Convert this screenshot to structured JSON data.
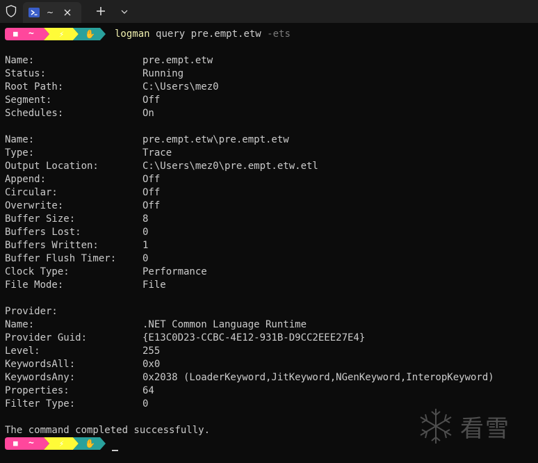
{
  "tabbar": {
    "tab_title": "~",
    "icons": [
      "shield-icon",
      "powershell-icon",
      "close-icon",
      "plus-icon",
      "chevron-down-icon"
    ]
  },
  "prompt": {
    "folder_glyph": "■",
    "home_glyph": "~",
    "bolt_glyph": "⚡",
    "hand_glyph": "✋",
    "colors": {
      "pink": "#ff479c",
      "yellow": "#fffb38",
      "teal": "#29a19c"
    }
  },
  "command": {
    "name": "logman",
    "args": "query pre.empt.etw",
    "flag": "-ets"
  },
  "session": [
    {
      "key": "Name:",
      "value": "pre.empt.etw"
    },
    {
      "key": "Status:",
      "value": "Running"
    },
    {
      "key": "Root Path:",
      "value": "C:\\Users\\mez0"
    },
    {
      "key": "Segment:",
      "value": "Off"
    },
    {
      "key": "Schedules:",
      "value": "On"
    }
  ],
  "trace": [
    {
      "key": "Name:",
      "value": "pre.empt.etw\\pre.empt.etw"
    },
    {
      "key": "Type:",
      "value": "Trace"
    },
    {
      "key": "Output Location:",
      "value": "C:\\Users\\mez0\\pre.empt.etw.etl"
    },
    {
      "key": "Append:",
      "value": "Off"
    },
    {
      "key": "Circular:",
      "value": "Off"
    },
    {
      "key": "Overwrite:",
      "value": "Off"
    },
    {
      "key": "Buffer Size:",
      "value": "8"
    },
    {
      "key": "Buffers Lost:",
      "value": "0"
    },
    {
      "key": "Buffers Written:",
      "value": "1"
    },
    {
      "key": "Buffer Flush Timer:",
      "value": "0"
    },
    {
      "key": "Clock Type:",
      "value": "Performance"
    },
    {
      "key": "File Mode:",
      "value": "File"
    }
  ],
  "provider_header": "Provider:",
  "provider": [
    {
      "key": "Name:",
      "value": ".NET Common Language Runtime"
    },
    {
      "key": "Provider Guid:",
      "value": "{E13C0D23-CCBC-4E12-931B-D9CC2EEE27E4}"
    },
    {
      "key": "Level:",
      "value": "255"
    },
    {
      "key": "KeywordsAll:",
      "value": "0x0"
    },
    {
      "key": "KeywordsAny:",
      "value": "0x2038 (LoaderKeyword,JitKeyword,NGenKeyword,InteropKeyword)"
    },
    {
      "key": "Properties:",
      "value": "64"
    },
    {
      "key": "Filter Type:",
      "value": "0"
    }
  ],
  "result": "The command completed successfully.",
  "watermark": {
    "text": "看雪",
    "icon": "snowflake-icon"
  }
}
